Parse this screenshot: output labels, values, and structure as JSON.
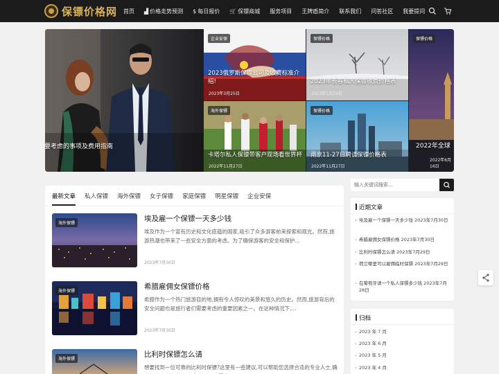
{
  "header": {
    "logo_text": "保镖价格网",
    "nav": [
      {
        "label": "首页",
        "icon": ""
      },
      {
        "label": "价格走势预测",
        "icon": "chart-icon"
      },
      {
        "label": "每日报价",
        "icon": "dollar-icon"
      },
      {
        "label": "保镖商城",
        "icon": "cart-icon"
      },
      {
        "label": "服务项目",
        "icon": ""
      },
      {
        "label": "王牌盾简介",
        "icon": ""
      },
      {
        "label": "联系我们",
        "icon": ""
      },
      {
        "label": "问答社区",
        "icon": ""
      },
      {
        "label": "我要提问",
        "icon": ""
      }
    ]
  },
  "slider": {
    "main": {
      "caption": "需要考虑的事项及费用指南"
    },
    "tiles": [
      {
        "tag": "企业安保",
        "caption": "2023俄罗斯保镖公司及收费标准介绍!",
        "date": "2023年3月25日"
      },
      {
        "tag": "保镖价格",
        "caption": "2023年长春私人保镖收费价格表",
        "date": "2023年1月19日"
      },
      {
        "tag": "海外保镖",
        "caption": "卡塔尔私人保镖带客户现场看世界杯",
        "date": "2022年11月27日"
      },
      {
        "tag": "保镖价格",
        "caption": "南京11-27日聘请保镖价格表",
        "date": "2022年11月27日"
      },
      {
        "tag": "保镖价格",
        "caption": "2022年全球",
        "date": "2022年6月16日"
      }
    ]
  },
  "tabs": [
    "最新文章",
    "私人保镖",
    "海外保镖",
    "女子保镖",
    "家庭保镖",
    "明星保镖",
    "企业安保"
  ],
  "posts": [
    {
      "tag": "海外保镖",
      "title": "埃及雇一个保镖一天多少钱",
      "excerpt": "埃及作为一个富有历史和文化底蕴的国家,吸引了众多游客前来探索和观光。然而,旅游热潮也带来了一些安全方面的考虑。为了确保游客的安全和保护...",
      "date": "2023年7月30日"
    },
    {
      "tag": "海外保镖",
      "title": "希腊雇佣女保镖价格",
      "excerpt": "希腊作为一个热门旅游目的地,拥有令人惊叹的美景和悠久的历史。然而,旅游背后的安全问题也是旅行者们需要考虑的重要因素之一。在这种情况下,...",
      "date": "2023年7月30日"
    },
    {
      "tag": "海外保镖",
      "title": "比利时保镖怎么请",
      "excerpt": "想要找到一位可靠的比利时保镖?这里有一些建议,可以帮助您选择合适的专业人士,确保您的安全。首先,考虑您的具体需求...",
      "date": ""
    }
  ],
  "search": {
    "placeholder": "输入关键词搜索..."
  },
  "recent": {
    "title": "近期文章",
    "items": [
      "埃及雇一个保镖一天多少钱 2023年7月30日",
      "希腊雇佣女保镖价格 2023年7月30日",
      "比利时保镖怎么请 2023年7月29日",
      "荷兰哪里可以雇佣临时保镖 2023年7月29日",
      "在葡萄牙请一个私人保镖多少钱 2023年7月28日"
    ]
  },
  "archive": {
    "title": "归档",
    "items": [
      "2023 年 7 月",
      "2023 年 6 月",
      "2023 年 5 月",
      "2023 年 4 月"
    ]
  }
}
